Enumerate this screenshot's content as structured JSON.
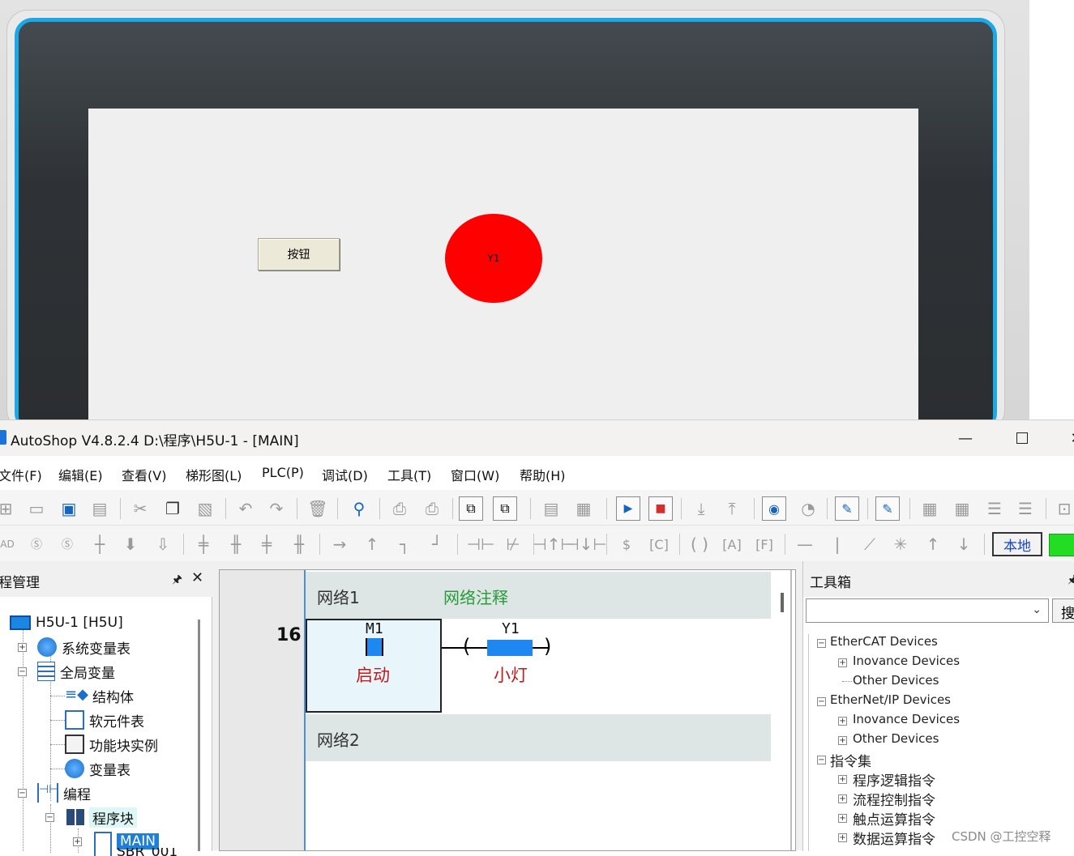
{
  "hmi": {
    "button_label": "按钮",
    "lamp_label": "Y1",
    "lamp_color": "#ff0000",
    "bezel_accent": "#1aa8e6"
  },
  "window": {
    "title": "AutoShop V4.8.2.4  D:\\程序\\H5U-1 - [MAIN]",
    "minimize": "—",
    "close": "✕"
  },
  "menu": [
    "文件(F)",
    "编辑(E)",
    "查看(V)",
    "梯形图(L)",
    "PLC(P)",
    "调试(D)",
    "工具(T)",
    "窗口(W)",
    "帮助(H)"
  ],
  "toolbar": {
    "local_label": "本地",
    "status_color": "#22dd22"
  },
  "project": {
    "title": "程管理",
    "pin": "ᵖ",
    "close": "✕",
    "root": "H5U-1 [H5U]",
    "items": [
      "系统变量表",
      "全局变量",
      "结构体",
      "软元件表",
      "功能块实例",
      "变量表",
      "编程",
      "程序块",
      "MAIN",
      "SBR_001"
    ]
  },
  "ladder": {
    "row_number": "16",
    "network1_label": "网络1",
    "network1_comment": "网络注释",
    "network2_label": "网络2",
    "contact_address": "M1",
    "contact_comment": "启动",
    "coil_address": "Y1",
    "coil_comment": "小灯",
    "coil_open": "(",
    "coil_close": ")"
  },
  "toolbox": {
    "title": "工具箱",
    "search_label": "搜",
    "tree": [
      {
        "label": "EtherCAT Devices",
        "level": 0
      },
      {
        "label": "Inovance Devices",
        "level": 1
      },
      {
        "label": "Other Devices",
        "level": 1
      },
      {
        "label": "EtherNet/IP Devices",
        "level": 0
      },
      {
        "label": "Inovance Devices",
        "level": 1
      },
      {
        "label": "Other Devices",
        "level": 1
      },
      {
        "label": "指令集",
        "level": 0
      },
      {
        "label": "程序逻辑指令",
        "level": 1
      },
      {
        "label": "流程控制指令",
        "level": 1
      },
      {
        "label": "触点运算指令",
        "level": 1
      },
      {
        "label": "数据运算指令",
        "level": 1
      }
    ]
  },
  "watermark": "CSDN @工控空释"
}
